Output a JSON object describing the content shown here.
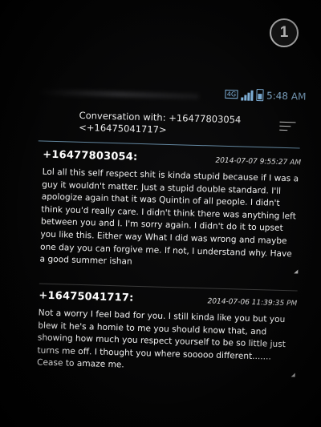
{
  "overlay": {
    "badge_number": "1"
  },
  "status_bar": {
    "network": "4G",
    "time": "5:48 AM",
    "icons": [
      "network-type-icon",
      "signal-icon",
      "battery-icon"
    ]
  },
  "header": {
    "line1": "Conversation with: +16477803054",
    "line2": "<+16475041717>",
    "menu_icon": "hamburger-menu-icon"
  },
  "messages": [
    {
      "sender": "+16477803054:",
      "timestamp": "2014-07-07 9:55:27 AM",
      "text": "Lol all this self respect shit is kinda stupid because if I was a guy it wouldn't matter. Just a stupid double standard. I'll apologize again that it was Quintin of all people. I didn't think you'd really care. I didn't think there was anything left between you and I. I'm sorry again. I didn't do it to upset you like this. Either way What I did was wrong and maybe one day you can forgive me. If not, I understand why. Have a good summer ishan"
    },
    {
      "sender": "+16475041717:",
      "timestamp": "2014-07-06 11:39:35 PM",
      "text": "Not a worry I feel bad for you. I still kinda like you but you blew it he's a homie to me you should know that, and showing how much you respect yourself to be so little just turns me off. I thought you where sooooo different....... Cease to amaze me."
    }
  ],
  "colors": {
    "background": "#050505",
    "accent_rule": "#7aa7c7",
    "status_icons": "#7fb0d8",
    "text": "#f0f0f0"
  }
}
